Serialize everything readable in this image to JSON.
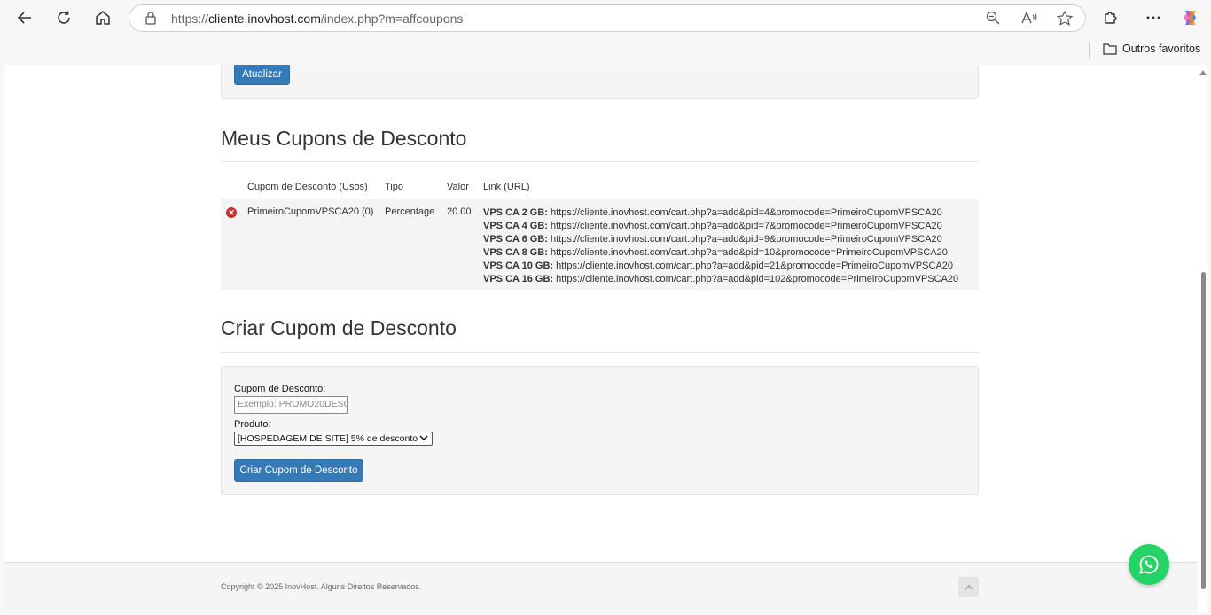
{
  "browser": {
    "url_prefix": "https://",
    "url_domain": "cliente.inovhost.com",
    "url_path": "/index.php?m=affcoupons",
    "favorites_label": "Outros favoritos"
  },
  "top_panel": {
    "update_button": "Atualizar"
  },
  "coupons_section": {
    "title": "Meus Cupons de Desconto",
    "columns": [
      "Cupom de Desconto (Usos)",
      "Tipo",
      "Valor",
      "Link (URL)"
    ],
    "row": {
      "code": "PrimeiroCupomVPSCA20 (0)",
      "type": "Percentage",
      "value": "20.00",
      "links": [
        {
          "plan": "VPS CA 2 GB:",
          "url": "https://cliente.inovhost.com/cart.php?a=add&pid=4&promocode=PrimeiroCupomVPSCA20"
        },
        {
          "plan": "VPS CA 4 GB:",
          "url": "https://cliente.inovhost.com/cart.php?a=add&pid=7&promocode=PrimeiroCupomVPSCA20"
        },
        {
          "plan": "VPS CA 6 GB:",
          "url": "https://cliente.inovhost.com/cart.php?a=add&pid=9&promocode=PrimeiroCupomVPSCA20"
        },
        {
          "plan": "VPS CA 8 GB:",
          "url": "https://cliente.inovhost.com/cart.php?a=add&pid=10&promocode=PrimeiroCupomVPSCA20"
        },
        {
          "plan": "VPS CA 10 GB:",
          "url": "https://cliente.inovhost.com/cart.php?a=add&pid=21&promocode=PrimeiroCupomVPSCA20"
        },
        {
          "plan": "VPS CA 16 GB:",
          "url": "https://cliente.inovhost.com/cart.php?a=add&pid=102&promocode=PrimeiroCupomVPSCA20"
        }
      ]
    }
  },
  "create_section": {
    "title": "Criar Cupom de Desconto",
    "coupon_label": "Cupom de Desconto:",
    "coupon_placeholder": "Exemplo: PROMO20DESC",
    "product_label": "Produto:",
    "product_selected": "[HOSPEDAGEM DE SITE] 5% de desconto",
    "submit_button": "Criar Cupom de Desconto"
  },
  "footer": {
    "copyright": "Copyright © 2025 InovHost. Alguns Direitos Reservados."
  },
  "colors": {
    "primary_button": "#337ab7",
    "whatsapp": "#25d366",
    "remove_icon": "#c9302c"
  }
}
